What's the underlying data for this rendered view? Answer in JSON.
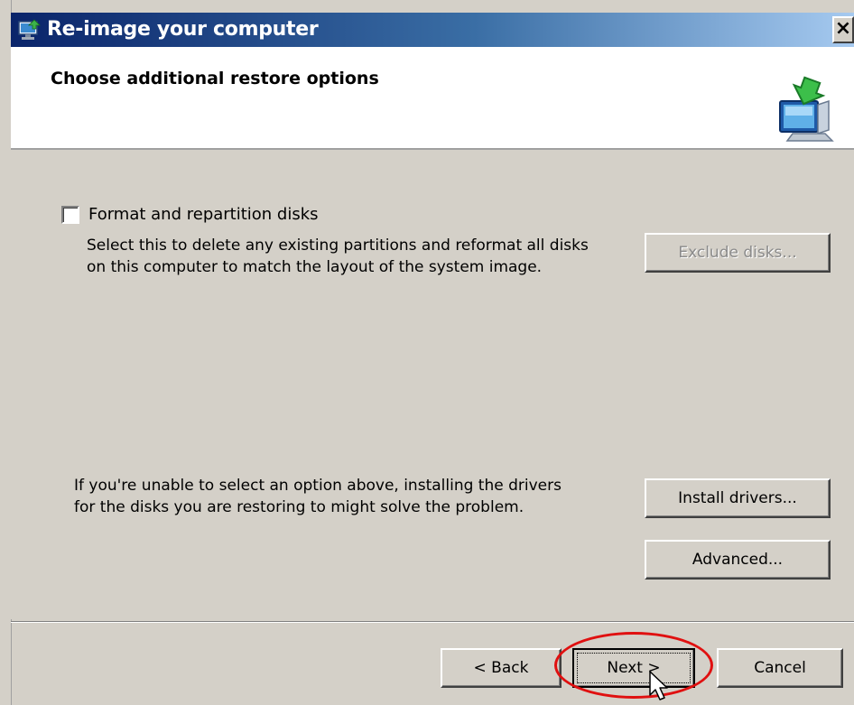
{
  "window": {
    "title": "Re-image your computer",
    "close_glyph": "×"
  },
  "header": {
    "title": "Choose additional restore options"
  },
  "options": {
    "format_checkbox_label": "Format and repartition disks",
    "format_checked": false,
    "format_desc_line1": "Select this to delete any existing partitions and reformat all disks",
    "format_desc_line2": "on this computer to match the layout of the system image.",
    "exclude_disks_label": "Exclude disks...",
    "drivers_desc_line1": "If you're unable to select an option above, installing the drivers",
    "drivers_desc_line2": "for the disks you are restoring to might solve the problem.",
    "install_drivers_label": "Install drivers...",
    "advanced_label": "Advanced..."
  },
  "footer": {
    "back_label": "< Back",
    "next_label": "Next >",
    "cancel_label": "Cancel"
  },
  "icons": {
    "title_icon": "computer-restore-icon",
    "header_icon": "computer-restore-arrow-icon",
    "cursor": "mouse-pointer-icon"
  },
  "colors": {
    "titlebar_start": "#0a246a",
    "titlebar_end": "#a6caf0",
    "dialog_bg": "#d4d0c8",
    "highlight_ellipse": "#e01010"
  }
}
